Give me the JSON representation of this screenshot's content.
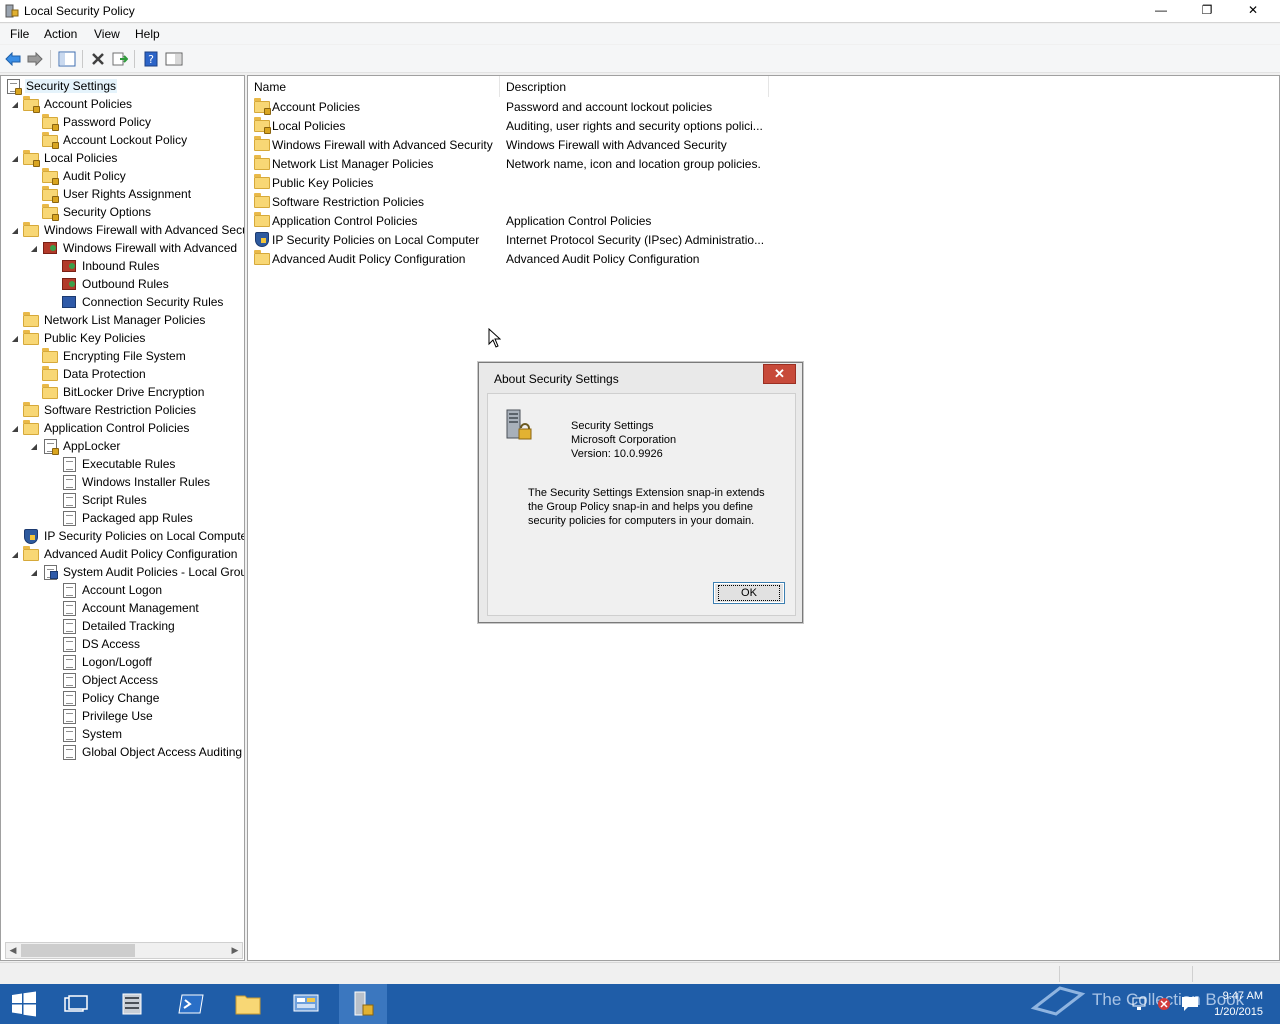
{
  "window": {
    "title": "Local Security Policy",
    "min_glyph": "—",
    "max_glyph": "❐",
    "close_glyph": "✕"
  },
  "menu": [
    "File",
    "Action",
    "View",
    "Help"
  ],
  "toolbar": {
    "icons": [
      "back-icon",
      "forward-icon",
      "show-hide-tree-icon",
      "delete-icon",
      "export-list-icon",
      "help-icon",
      "properties-pane-icon"
    ]
  },
  "tree": {
    "items": [
      {
        "label": "Security Settings",
        "expander": "",
        "icon": "security-settings-icon"
      },
      {
        "label": "Account Policies",
        "expander": "◢",
        "icon": "folder-lock-icon"
      },
      {
        "label": "Password Policy",
        "expander": "",
        "icon": "folder-lock-icon"
      },
      {
        "label": "Account Lockout Policy",
        "expander": "",
        "icon": "folder-lock-icon"
      },
      {
        "label": "Local Policies",
        "expander": "◢",
        "icon": "folder-lock-icon"
      },
      {
        "label": "Audit Policy",
        "expander": "",
        "icon": "folder-lock-icon"
      },
      {
        "label": "User Rights Assignment",
        "expander": "",
        "icon": "folder-lock-icon"
      },
      {
        "label": "Security Options",
        "expander": "",
        "icon": "folder-lock-icon"
      },
      {
        "label": "Windows Firewall with Advanced Secu",
        "expander": "◢",
        "icon": "folder-icon"
      },
      {
        "label": "Windows Firewall with Advanced",
        "expander": "◢",
        "icon": "firewall-icon"
      },
      {
        "label": "Inbound Rules",
        "expander": "",
        "icon": "firewall-icon"
      },
      {
        "label": "Outbound Rules",
        "expander": "",
        "icon": "firewall-icon"
      },
      {
        "label": "Connection Security Rules",
        "expander": "",
        "icon": "network-icon"
      },
      {
        "label": "Network List Manager Policies",
        "expander": "",
        "icon": "folder-icon"
      },
      {
        "label": "Public Key Policies",
        "expander": "◢",
        "icon": "folder-icon"
      },
      {
        "label": "Encrypting File System",
        "expander": "",
        "icon": "folder-icon"
      },
      {
        "label": "Data Protection",
        "expander": "",
        "icon": "folder-icon"
      },
      {
        "label": "BitLocker Drive Encryption",
        "expander": "",
        "icon": "folder-icon"
      },
      {
        "label": "Software Restriction Policies",
        "expander": "",
        "icon": "folder-icon"
      },
      {
        "label": "Application Control Policies",
        "expander": "◢",
        "icon": "folder-icon"
      },
      {
        "label": "AppLocker",
        "expander": "◢",
        "icon": "applocker-icon"
      },
      {
        "label": "Executable Rules",
        "expander": "",
        "icon": "rules-icon"
      },
      {
        "label": "Windows Installer Rules",
        "expander": "",
        "icon": "rules-icon"
      },
      {
        "label": "Script Rules",
        "expander": "",
        "icon": "rules-icon"
      },
      {
        "label": "Packaged app Rules",
        "expander": "",
        "icon": "rules-icon"
      },
      {
        "label": "IP Security Policies on Local Compute",
        "expander": "",
        "icon": "ipsec-icon"
      },
      {
        "label": "Advanced Audit Policy Configuration",
        "expander": "◢",
        "icon": "folder-icon"
      },
      {
        "label": "System Audit Policies - Local Grou",
        "expander": "◢",
        "icon": "audit-policies-icon"
      },
      {
        "label": "Account Logon",
        "expander": "",
        "icon": "audit-category-icon"
      },
      {
        "label": "Account Management",
        "expander": "",
        "icon": "audit-category-icon"
      },
      {
        "label": "Detailed Tracking",
        "expander": "",
        "icon": "audit-category-icon"
      },
      {
        "label": "DS Access",
        "expander": "",
        "icon": "audit-category-icon"
      },
      {
        "label": "Logon/Logoff",
        "expander": "",
        "icon": "audit-category-icon"
      },
      {
        "label": "Object Access",
        "expander": "",
        "icon": "audit-category-icon"
      },
      {
        "label": "Policy Change",
        "expander": "",
        "icon": "audit-category-icon"
      },
      {
        "label": "Privilege Use",
        "expander": "",
        "icon": "audit-category-icon"
      },
      {
        "label": "System",
        "expander": "",
        "icon": "audit-category-icon"
      },
      {
        "label": "Global Object Access Auditing",
        "expander": "",
        "icon": "audit-category-icon"
      }
    ]
  },
  "list": {
    "columns": [
      "Name",
      "Description"
    ],
    "rows": [
      {
        "name": "Account Policies",
        "description": "Password and account lockout policies",
        "icon": "folder-lock-icon"
      },
      {
        "name": "Local Policies",
        "description": "Auditing, user rights and security options polici...",
        "icon": "folder-lock-icon"
      },
      {
        "name": "Windows Firewall with Advanced Security",
        "description": "Windows Firewall with Advanced Security",
        "icon": "folder-icon"
      },
      {
        "name": "Network List Manager Policies",
        "description": "Network name, icon and location group policies.",
        "icon": "folder-icon"
      },
      {
        "name": "Public Key Policies",
        "description": "",
        "icon": "folder-icon"
      },
      {
        "name": "Software Restriction Policies",
        "description": "",
        "icon": "folder-icon"
      },
      {
        "name": "Application Control Policies",
        "description": "Application Control Policies",
        "icon": "folder-icon"
      },
      {
        "name": "IP Security Policies on Local Computer",
        "description": "Internet Protocol Security (IPsec) Administratio...",
        "icon": "ipsec-icon"
      },
      {
        "name": "Advanced Audit Policy Configuration",
        "description": "Advanced Audit Policy Configuration",
        "icon": "folder-icon"
      }
    ]
  },
  "dialog": {
    "title": "About Security Settings",
    "close_glyph": "✕",
    "product": "Security Settings",
    "company": "Microsoft Corporation",
    "version": "Version: 10.0.9926",
    "description": "The Security Settings Extension snap-in extends the Group Policy snap-in and helps you define security policies for computers in your domain.",
    "ok_label": "OK"
  },
  "taskbar": {
    "apps": [
      "start-icon",
      "task-view-icon",
      "server-manager-icon",
      "powershell-icon",
      "file-explorer-icon",
      "control-panel-icon",
      "local-security-policy-icon"
    ],
    "time": "9:47 AM",
    "date": "1/20/2015",
    "watermark": "The Collection Book"
  },
  "colors": {
    "taskbar": "#1f5da8",
    "dialog_close": "#c74a3a",
    "folder": "#f8d775"
  }
}
